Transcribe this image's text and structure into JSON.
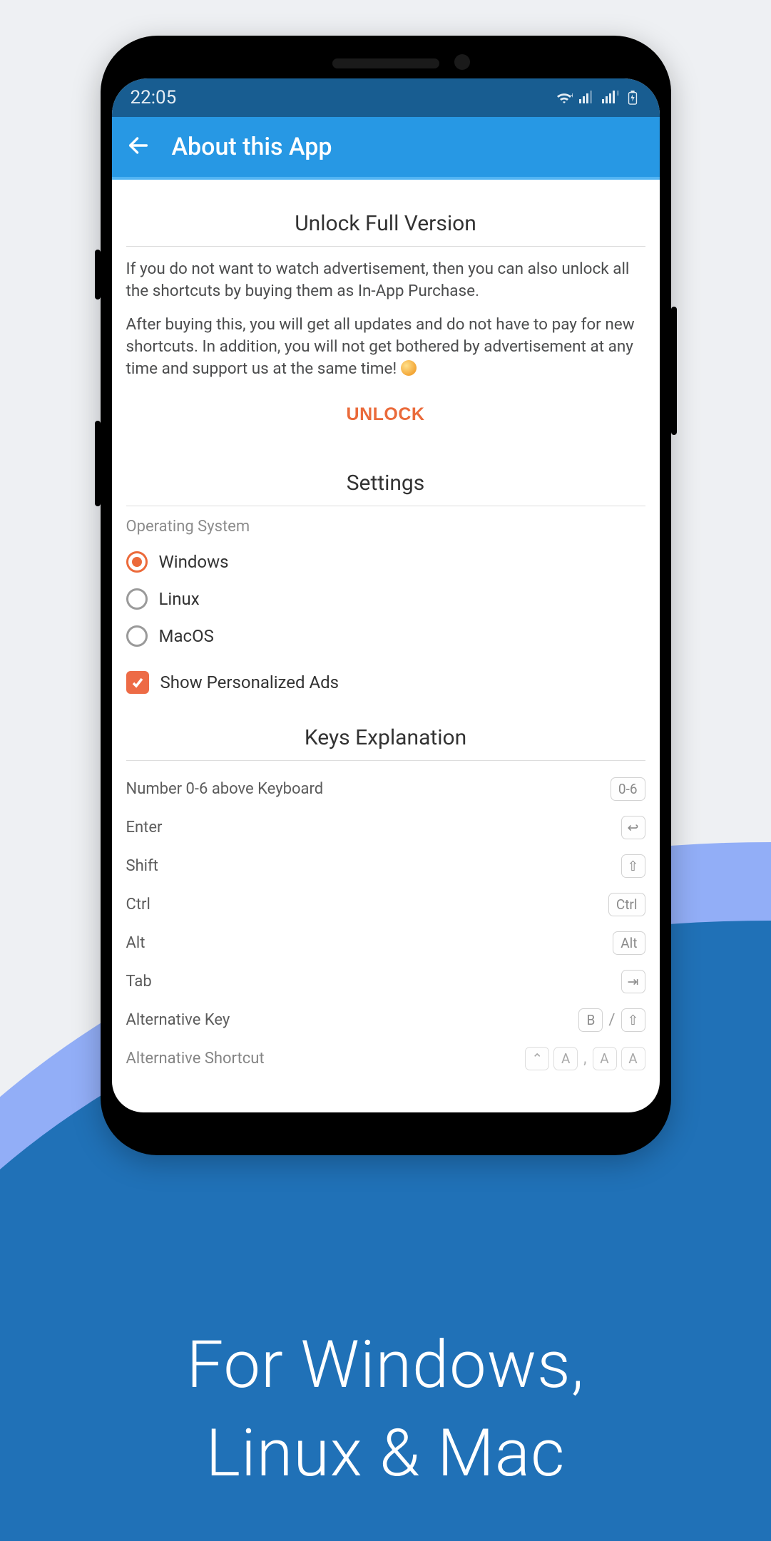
{
  "promo": {
    "line1": "For  Windows,",
    "line2": "Linux  &  Mac"
  },
  "status": {
    "time": "22:05"
  },
  "appbar": {
    "title": "About this App"
  },
  "unlock": {
    "title": "Unlock Full Version",
    "para1": "If you do not want to watch advertisement, then you can also unlock all the shortcuts by buying them as In-App Purchase.",
    "para2": "After buying this, you will get all updates and do not have to pay for new shortcuts. In addition, you will not get bothered by advertisement at any time and support us at the same time! ",
    "button": "UNLOCK"
  },
  "settings": {
    "title": "Settings",
    "os_label": "Operating System",
    "options": {
      "windows": "Windows",
      "linux": "Linux",
      "macos": "MacOS"
    },
    "selected": "windows",
    "ads_label": "Show Personalized Ads",
    "ads_checked": true
  },
  "keys": {
    "title": "Keys Explanation",
    "rows": [
      {
        "label": "Number 0-6 above Keyboard",
        "badges": [
          "0-6"
        ]
      },
      {
        "label": "Enter",
        "badges": [
          "↩"
        ]
      },
      {
        "label": "Shift",
        "badges": [
          "⇧"
        ]
      },
      {
        "label": "Ctrl",
        "badges": [
          "Ctrl"
        ]
      },
      {
        "label": "Alt",
        "badges": [
          "Alt"
        ]
      },
      {
        "label": "Tab",
        "badges": [
          "⇥"
        ]
      },
      {
        "label": "Alternative Key",
        "badges": [
          "B",
          "/",
          "⇧"
        ],
        "sep": "/"
      },
      {
        "label": "Alternative Shortcut",
        "badges": [
          "⌃",
          "A",
          ",",
          "A",
          "A"
        ],
        "sep": ","
      }
    ]
  }
}
